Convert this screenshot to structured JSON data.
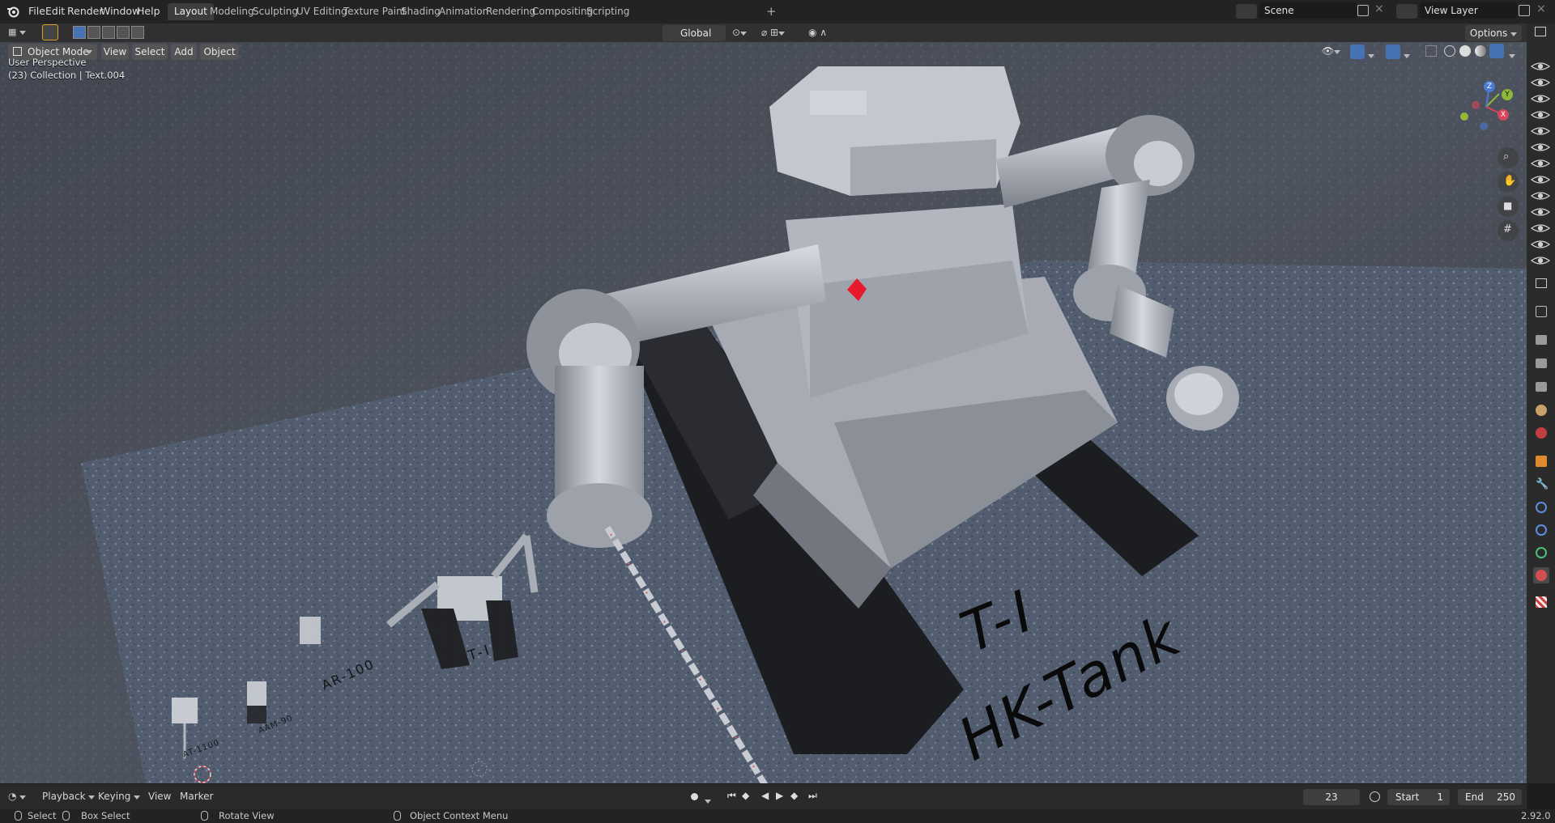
{
  "menu": {
    "file": "File",
    "edit": "Edit",
    "render": "Render",
    "window": "Window",
    "help": "Help"
  },
  "workspaces": [
    "Layout",
    "Modeling",
    "Sculpting",
    "UV Editing",
    "Texture Paint",
    "Shading",
    "Animation",
    "Rendering",
    "Compositing",
    "Scripting"
  ],
  "scene": {
    "label": "Scene",
    "view_layer": "View Layer"
  },
  "tool_header": {
    "orientation": "Global",
    "options": "Options"
  },
  "viewport_header": {
    "mode": "Object Mode",
    "view": "View",
    "select": "Select",
    "add": "Add",
    "object": "Object"
  },
  "viewport_overlay": {
    "perspective": "User Perspective",
    "collection": "(23) Collection | Text.004"
  },
  "gizmo": {
    "x": "X",
    "y": "Y",
    "z": "Z"
  },
  "scene_text": {
    "title_line1": "T-I",
    "title_line2": "HK-Tank",
    "small_t1": "T-I",
    "ar100": "AR-100",
    "aam90": "AAM-90",
    "at1100": "AT-1100"
  },
  "timeline": {
    "playback": "Playback",
    "keying": "Keying",
    "view": "View",
    "marker": "Marker",
    "current_frame": "23",
    "start_label": "Start",
    "start": "1",
    "end_label": "End",
    "end": "250"
  },
  "status": {
    "select": "Select",
    "box_select": "Box Select",
    "rotate_view": "Rotate View",
    "context_menu": "Object Context Menu",
    "version": "2.92.0"
  },
  "colors": {
    "accent": "#4772b3",
    "active_tab": "#3d3d3d",
    "asphalt": "#505966",
    "robot": "#b8bcc6",
    "tread": "#1e1f22",
    "emblem": "#e8192c"
  }
}
